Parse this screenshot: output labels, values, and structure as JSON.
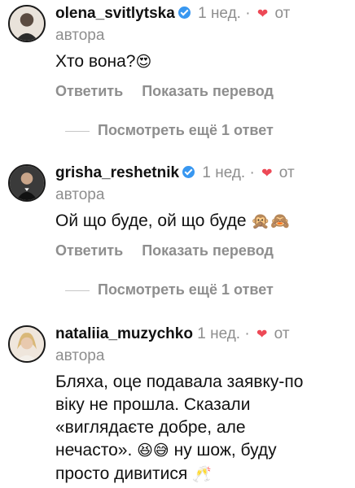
{
  "comments": [
    {
      "username": "olena_svitlytska",
      "time": "1 нед.",
      "separator": "·",
      "author_label_1": "от",
      "author_label_2": "автора",
      "text": "Хто вона?",
      "emoji": "😍",
      "reply": "Ответить",
      "translate": "Показать перевод",
      "more_replies": "Посмотреть ещё 1 ответ"
    },
    {
      "username": "grisha_reshetnik",
      "time": "1 нед.",
      "separator": "·",
      "author_label_1": "от",
      "author_label_2": "автора",
      "text": "Ой що буде, ой що буде",
      "emoji": "🙊🙈",
      "reply": "Ответить",
      "translate": "Показать перевод",
      "more_replies": "Посмотреть ещё 1 ответ"
    },
    {
      "username": "nataliia_muzychko",
      "time": "1 нед.",
      "separator": "·",
      "author_label_1": "от",
      "author_label_2": "автора",
      "text_line1": "Бляха, оце подавала заявку-по",
      "text_line2": "віку не прошла. Сказали",
      "text_line3": "«виглядаєте добре, але",
      "text_line4a": "нечасто».",
      "text_line4_emoji": "😆😅",
      "text_line4b": "ну шож, буду",
      "text_line5": "просто дивитися",
      "text_line5_emoji": "🥂"
    }
  ],
  "colors": {
    "accent_heart": "#ed4956",
    "verified": "#3897f0",
    "meta_gray": "#8e8e8e"
  },
  "icons": [
    "verified-badge-icon",
    "heart-icon"
  ]
}
